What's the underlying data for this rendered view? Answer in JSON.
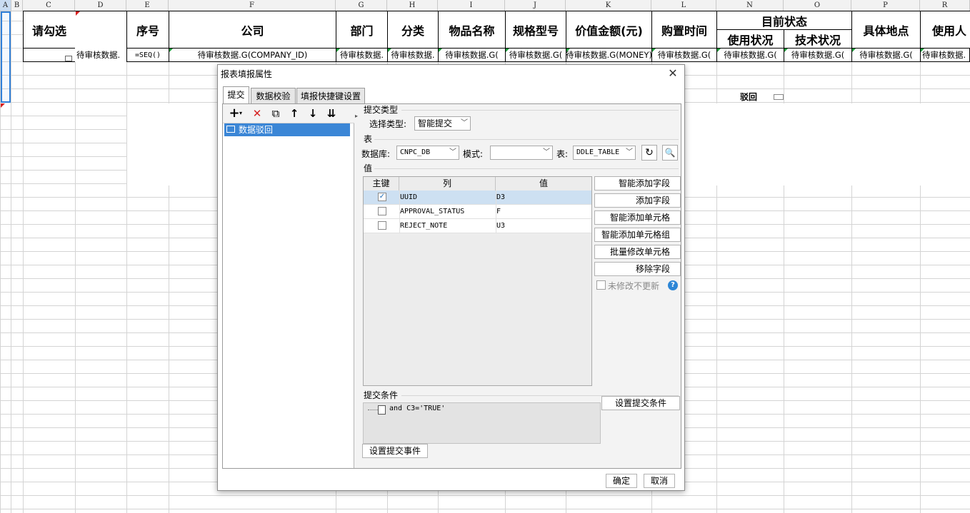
{
  "sheet": {
    "columns": [
      "A",
      "B",
      "C",
      "D",
      "E",
      "F",
      "G",
      "H",
      "I",
      "J",
      "K",
      "L",
      "N",
      "O",
      "P",
      "R"
    ],
    "headers": {
      "check": "请勾选",
      "seq": "序号",
      "company": "公司",
      "dept": "部门",
      "category": "分类",
      "item_name": "物品名称",
      "spec": "规格型号",
      "value": "价值金额(元)",
      "purchase_time": "购置时间",
      "current_status": "目前状态",
      "usage_status": "使用状况",
      "tech_status": "技术状况",
      "location": "具体地点",
      "user": "使用人"
    },
    "row": {
      "d": "待审核数据.",
      "e": "=SEQ()",
      "f": "待审核数据.G(COMPANY_ID)",
      "g": "待审核数据.",
      "h": "待审核数据.",
      "i": "待审核数据.G(",
      "j": "待审核数据.G(",
      "k": "待审核数据.G(MONEY)",
      "l": "待审核数据.G(",
      "n": "待审核数据.G(",
      "o": "待审核数据.G(",
      "p": "待审核数据.G(",
      "r": "待审核数据."
    },
    "reject_label": "驳回"
  },
  "dialog": {
    "title": "报表填报属性",
    "close": "✕",
    "tabs": [
      "提交",
      "数据校验",
      "填报快捷键设置"
    ],
    "toolbar": {
      "add": "+",
      "add_caret": "▾",
      "delete": "✕",
      "copy": "⧉",
      "up": "↑",
      "down": "↓",
      "bottom": "⇊"
    },
    "tree_item": "数据驳回",
    "submit_type": {
      "section": "提交类型",
      "label": "选择类型:",
      "value": "智能提交"
    },
    "table_section": {
      "section": "表",
      "db_label": "数据库:",
      "db_value": "CNPC_DB",
      "schema_label": "模式:",
      "schema_value": "",
      "table_label": "表:",
      "table_value": "DDLE_TABLE"
    },
    "value_section": {
      "section": "值",
      "columns": [
        "主键",
        "列",
        "值"
      ],
      "rows": [
        {
          "key": "✓",
          "col": "UUID",
          "val": "D3"
        },
        {
          "key": "",
          "col": "APPROVAL_STATUS",
          "val": "F"
        },
        {
          "key": "",
          "col": "REJECT_NOTE",
          "val": "U3"
        }
      ]
    },
    "side_buttons": [
      "智能添加字段",
      "添加字段",
      "智能添加单元格",
      "智能添加单元格组",
      "批量修改单元格",
      "移除字段"
    ],
    "no_update_label": "未修改不更新",
    "help": "?",
    "condition": {
      "section": "提交条件",
      "text": "and C3='TRUE'",
      "button": "设置提交条件"
    },
    "event_button": "设置提交事件",
    "ok": "确定",
    "cancel": "取消"
  }
}
